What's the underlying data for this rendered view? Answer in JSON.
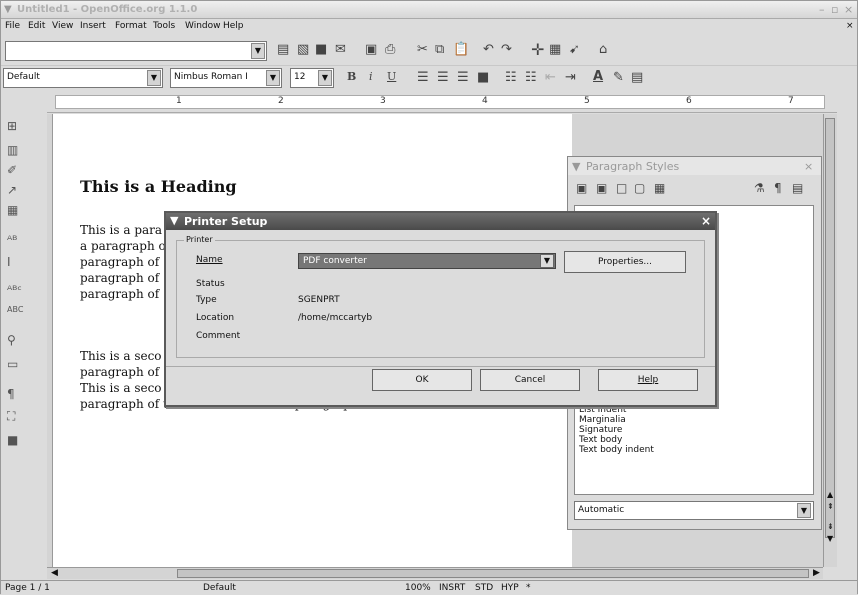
{
  "window": {
    "title": "Untitled1 - OpenOffice.org 1.1.0"
  },
  "menu": [
    "File",
    "Edit",
    "View",
    "Insert",
    "Format",
    "Tools",
    "Window",
    "Help"
  ],
  "formatbar": {
    "style": "Default",
    "font": "Nimbus Roman I",
    "size": "12"
  },
  "ruler": {
    "marks": [
      "1",
      "2",
      "3",
      "4",
      "5",
      "6",
      "7"
    ]
  },
  "document": {
    "heading": "This is a Heading",
    "para1": [
      "This is a para",
      "a paragraph o",
      "paragraph of",
      "paragraph of",
      "paragraph of"
    ],
    "para2": [
      "This is a seco",
      "paragraph of",
      "This is a seco",
      "paragraph of text. This is a second paragraph of text."
    ]
  },
  "stylist": {
    "title": "Paragraph Styles",
    "items": [
      "List Indent",
      "Marginalia",
      "Signature",
      "Text body",
      "Text body indent"
    ],
    "filter": "Automatic"
  },
  "dialog": {
    "title": "Printer Setup",
    "group_label": "Printer",
    "name_label": "Name",
    "name_value": "PDF converter",
    "properties_label": "Properties...",
    "status_label": "Status",
    "status_value": "",
    "type_label": "Type",
    "type_value": "SGENPRT",
    "location_label": "Location",
    "location_value": "/home/mccartyb",
    "comment_label": "Comment",
    "comment_value": "",
    "ok_label": "OK",
    "cancel_label": "Cancel",
    "help_label": "Help"
  },
  "statusbar": {
    "page": "Page 1 / 1",
    "style": "Default",
    "zoom": "100%",
    "mode1": "INSRT",
    "mode2": "STD",
    "mode3": "HYP",
    "mode4": "*"
  }
}
